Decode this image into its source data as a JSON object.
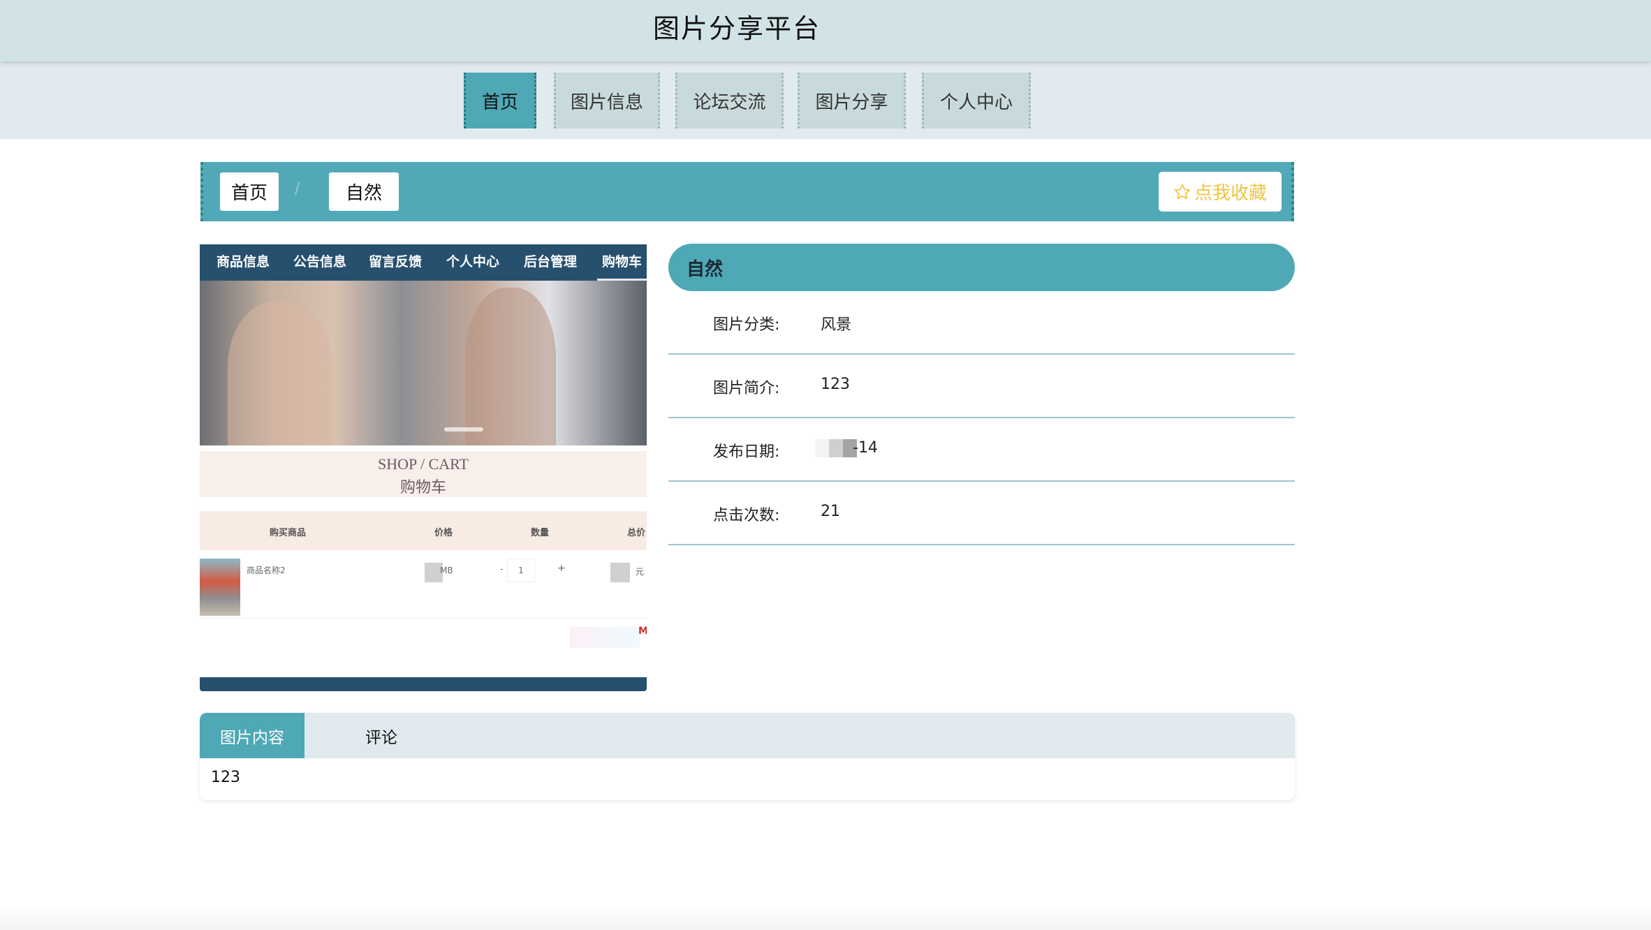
{
  "site": {
    "title": "图片分享平台"
  },
  "nav": {
    "items": [
      {
        "label": "首页",
        "active": true
      },
      {
        "label": "图片信息",
        "active": false
      },
      {
        "label": "论坛交流",
        "active": false
      },
      {
        "label": "图片分享",
        "active": false
      },
      {
        "label": "个人中心",
        "active": false
      }
    ]
  },
  "breadcrumb": {
    "home": "首页",
    "separator": "/",
    "current": "自然",
    "favorite_label": "点我收藏",
    "favorite_icon": "star-outline-icon"
  },
  "image_preview": {
    "nav": [
      "商品信息",
      "公告信息",
      "留言反馈",
      "个人中心",
      "后台管理",
      "购物车"
    ],
    "cart_title_en": "SHOP / CART",
    "cart_title_cn": "购物车",
    "table_headers": [
      "购买商品",
      "价格",
      "数量",
      "总价"
    ],
    "row": {
      "name": "商品名称2",
      "price_suffix": "MB",
      "quantity": "1",
      "minus": "-",
      "plus": "+",
      "total_suffix": "元",
      "footer_mark": "M"
    }
  },
  "details": {
    "title": "自然",
    "rows": [
      {
        "key": "图片分类:",
        "value": "风景"
      },
      {
        "key": "图片简介:",
        "value": "123"
      },
      {
        "key": "发布日期:",
        "value": "-14"
      },
      {
        "key": "点击次数:",
        "value": "21"
      }
    ]
  },
  "tabs": {
    "items": [
      "图片内容",
      "评论"
    ],
    "content": "123"
  },
  "colors": {
    "accent": "#4ea8b6",
    "header_bg": "#d1e3e6",
    "nav_bg": "#e1eaee",
    "favorite": "#efc53f",
    "preview_nav": "#27506e"
  }
}
